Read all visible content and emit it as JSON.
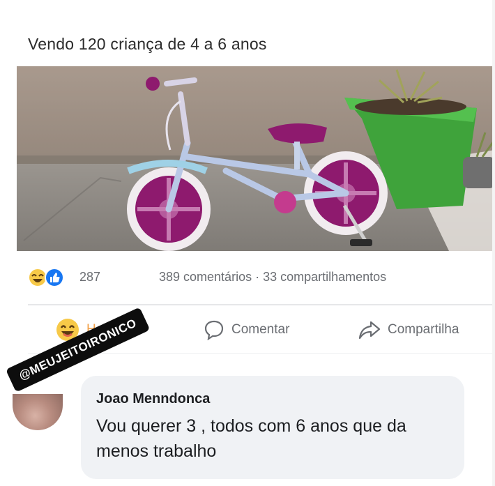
{
  "post": {
    "title": "Vendo 120 criança de 4 a 6 anos"
  },
  "stats": {
    "reaction_count": "287",
    "comments_and_shares": "389 comentários · 33 compartilhamentos",
    "reaction_icons": [
      "haha-icon",
      "like-icon"
    ]
  },
  "actions": {
    "haha": "Haha",
    "comment": "Comentar",
    "share": "Compartilha"
  },
  "watermark": {
    "text": "@MEUJEITOIRONICO"
  },
  "comment": {
    "author": "Joao Menndonca",
    "text": "Vou querer 3 , todos com 6 anos que da menos trabalho"
  },
  "colors": {
    "haha_accent": "#f2a14a",
    "like_blue": "#1877f2",
    "bubble_bg": "#f0f2f5",
    "bike_purple": "#8e1a6e"
  }
}
